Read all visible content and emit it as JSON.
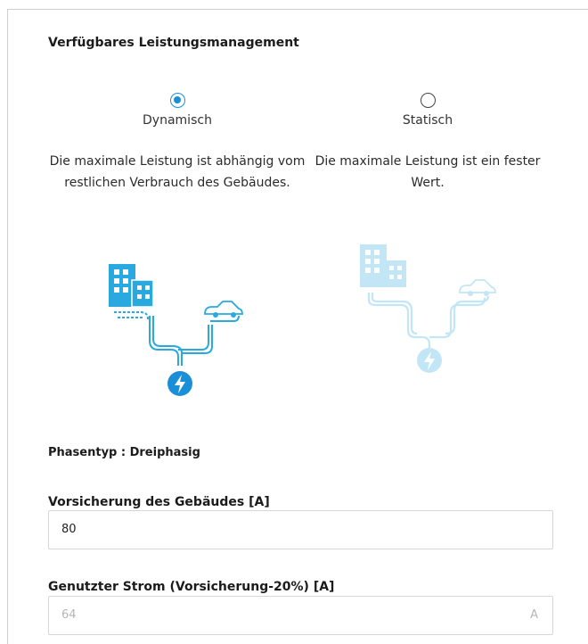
{
  "section_title": "Verfügbares Leistungsmanagement",
  "options": [
    {
      "label": "Dynamisch",
      "selected": true,
      "description": "Die maximale Leistung ist abhängig vom restlichen Verbrauch des Gebäudes."
    },
    {
      "label": "Statisch",
      "selected": false,
      "description": "Die maximale Leistung ist ein fester Wert."
    }
  ],
  "phase": {
    "label": "Phasentyp : ",
    "value": "Dreiphasig"
  },
  "fuse_field": {
    "label": "Vorsicherung des Gebäudes [A]",
    "value": "80"
  },
  "used_current_field": {
    "label": "Genutzter Strom (Vorsicherung-20%) [A]",
    "value": "64",
    "unit": "A"
  },
  "colors": {
    "accent": "#1a8fd8",
    "illustration": "#29a9e0"
  },
  "icons": [
    "building-icon",
    "car-icon",
    "charging-bolt-icon"
  ]
}
